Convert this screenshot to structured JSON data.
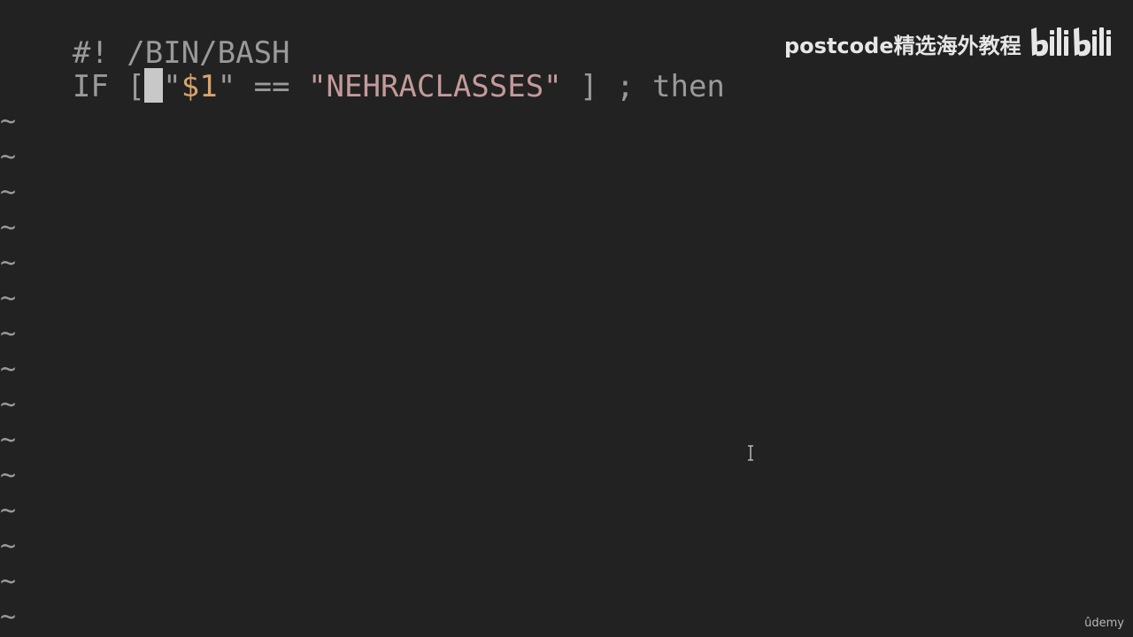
{
  "editor": {
    "line1": {
      "text": "#! /BIN/BASH"
    },
    "line2": {
      "kw_if": "IF",
      "open_bracket": " [ ",
      "q1": "\"",
      "var": "$1",
      "q2": "\"",
      "op": " == ",
      "str": "\"NEHRACLASSES\"",
      "close": " ] ; then"
    },
    "tilde_char": "~"
  },
  "watermark": {
    "text": "postcode精选海外教程",
    "logo": "bilibili-logo"
  },
  "footer": {
    "udemy": "ûdemy"
  },
  "colors": {
    "background": "#222222",
    "text": "#9a9a9a",
    "string": "#c49a9a",
    "variable": "#d9a36a",
    "cursor": "#c8c8c8",
    "watermark": "#e6e6e6"
  }
}
